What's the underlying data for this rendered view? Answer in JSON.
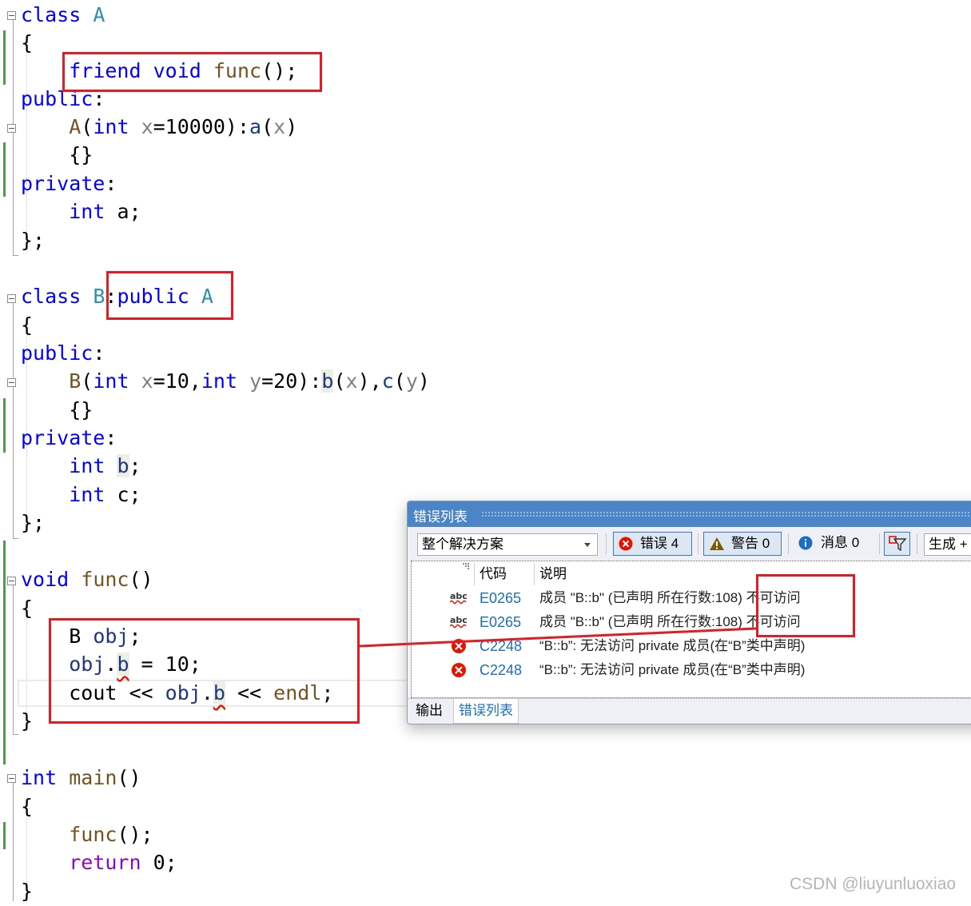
{
  "editor": {
    "lines": {
      "l1": [
        "class",
        "A"
      ],
      "l2": "{",
      "l3": [
        "friend",
        "void",
        "func",
        "();"
      ],
      "l4": [
        "public",
        ":"
      ],
      "l5": [
        "A",
        "(",
        "int",
        "x",
        "=10000):",
        "a",
        "(",
        "x",
        ")"
      ],
      "l6": "{}",
      "l7": [
        "private",
        ":"
      ],
      "l8": [
        "int",
        "a;"
      ],
      "l9": "};",
      "l10": [
        "class",
        "B",
        ":",
        "public",
        "A"
      ],
      "l11": "{",
      "l12": [
        "public",
        ":"
      ],
      "l13": [
        "B",
        "(",
        "int",
        "x",
        "=10,",
        "int",
        "y",
        "=20):",
        "b",
        "(",
        "x",
        "),",
        "c",
        "(",
        "y",
        ")"
      ],
      "l14": "{}",
      "l15": [
        "private",
        ":"
      ],
      "l16": [
        "int",
        "b",
        ";"
      ],
      "l17": [
        "int",
        "c;"
      ],
      "l18": "};",
      "l19": [
        "void",
        "func",
        "()"
      ],
      "l20": "{",
      "l21": [
        "B",
        "obj",
        ";"
      ],
      "l22": [
        "obj",
        ".",
        "b",
        " = 10;"
      ],
      "l23": [
        "cout",
        " << ",
        "obj",
        ".",
        "b",
        " << ",
        "endl",
        ";"
      ],
      "l24": "}",
      "l25": [
        "int",
        "main",
        "()"
      ],
      "l26": "{",
      "l27": [
        "func",
        "();"
      ],
      "l28": [
        "return",
        " 0;"
      ],
      "l29": "}"
    }
  },
  "error_list": {
    "title": "错误列表",
    "scope": "整个解决方案",
    "errors_label": "错误 4",
    "warnings_label": "警告 0",
    "messages_label": "消息 0",
    "build_label": "生成 +",
    "headers": {
      "code": "代码",
      "description": "说明"
    },
    "rows": [
      {
        "code": "E0265",
        "description": "成员 \"B::b\" (已声明 所在行数:108) 不可访问",
        "kind": "intellisense"
      },
      {
        "code": "E0265",
        "description": "成员 \"B::b\" (已声明 所在行数:108) 不可访问",
        "kind": "intellisense"
      },
      {
        "code": "C2248",
        "description": "“B::b”: 无法访问 private 成员(在“B”类中声明)",
        "kind": "error"
      },
      {
        "code": "C2248",
        "description": "“B::b”: 无法访问 private 成员(在“B”类中声明)",
        "kind": "error"
      }
    ],
    "tabs": [
      "输出",
      "错误列表"
    ]
  },
  "watermark": "CSDN @liuyunluoxiao",
  "colors": {
    "keyword": "#0000ff",
    "type": "#2b91af",
    "function": "#74531f",
    "parameter": "#808080",
    "member": "#1f377f",
    "annotation_red": "#e31c23",
    "panel_title": "#4b84c7"
  }
}
